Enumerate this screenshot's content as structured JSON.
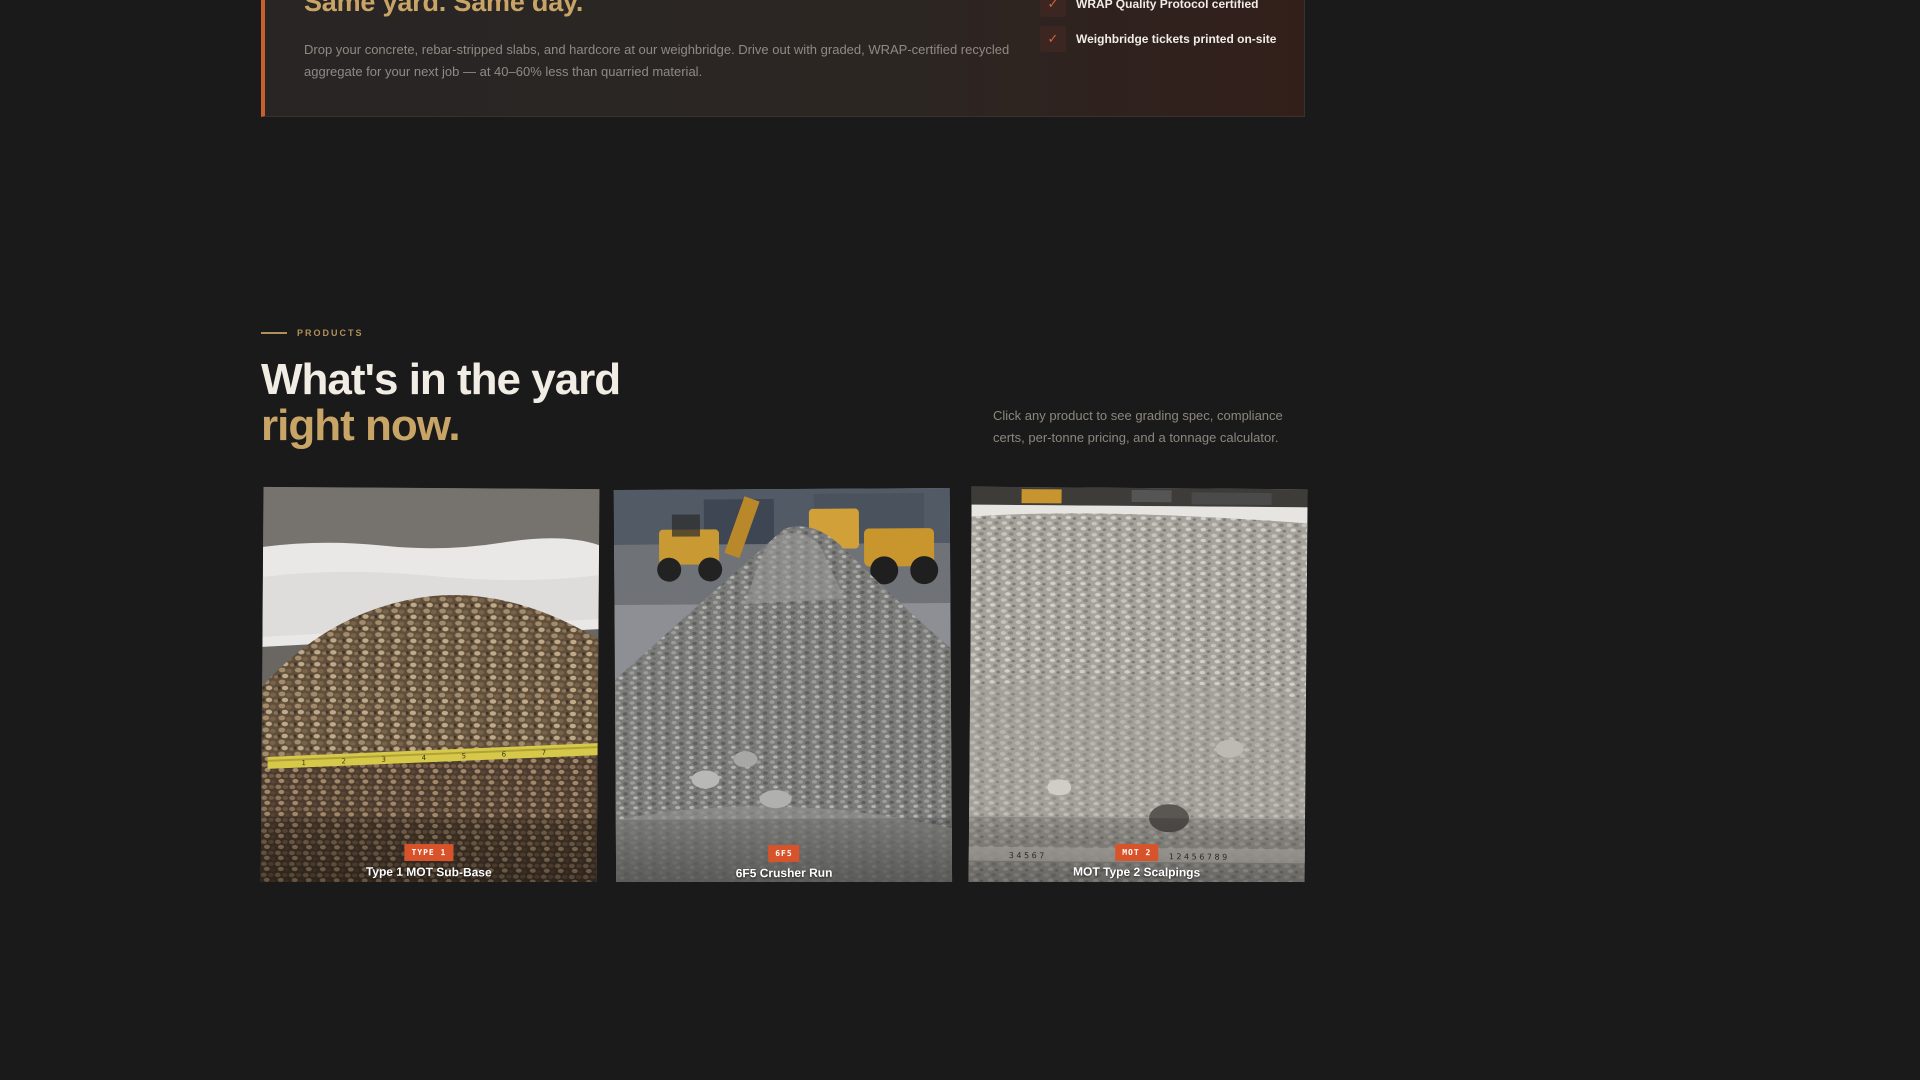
{
  "hero": {
    "heading": "Same yard. Same day.",
    "body": "Drop your concrete, rebar-stripped slabs, and hardcore at our weighbridge. Drive out with graded, WRAP-certified recycled aggregate for your next job — at 40–60% less than quarried material.",
    "checklist": [
      {
        "label": "WRAP Quality Protocol certified",
        "icon": "check-icon"
      },
      {
        "label": "Weighbridge tickets printed on-site",
        "icon": "check-icon"
      }
    ]
  },
  "products": {
    "eyebrow": "PRODUCTS",
    "title_line_1": "What's in the yard",
    "title_line_2": "right now.",
    "intro": "Click any product to see grading spec, compliance certs, per-tonne pricing, and a tonnage calculator.",
    "cards": [
      {
        "badge": "TYPE 1",
        "title": "Type 1 MOT Sub-Base"
      },
      {
        "badge": "6F5",
        "title": "6F5 Crusher Run"
      },
      {
        "badge": "MOT 2",
        "title": "MOT Type 2 Scalpings"
      }
    ]
  },
  "colors": {
    "background": "#1a1a1a",
    "accent": "#c8602e",
    "gold": "#c9a467",
    "badge": "#d9532a"
  }
}
